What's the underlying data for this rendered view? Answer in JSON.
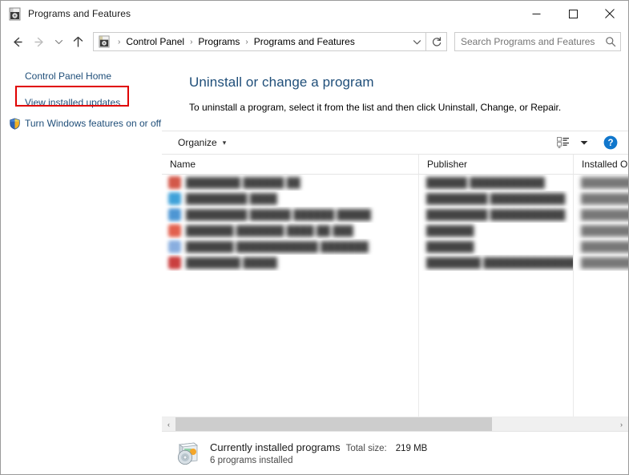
{
  "window": {
    "title": "Programs and Features",
    "icon": "programs-and-features-icon",
    "minimize_label": "Minimize",
    "maximize_label": "Maximize",
    "close_label": "Close"
  },
  "nav": {
    "back_label": "Back",
    "forward_label": "Forward",
    "recent_label": "Recent locations",
    "up_label": "Up",
    "refresh_label": "Refresh",
    "breadcrumbs": [
      {
        "label": "Control Panel"
      },
      {
        "label": "Programs"
      },
      {
        "label": "Programs and Features"
      }
    ],
    "breadcrumb_separator": "›"
  },
  "search": {
    "placeholder": "Search Programs and Features",
    "value": ""
  },
  "sidebar": {
    "items": [
      {
        "label": "Control Panel Home",
        "icon": null,
        "highlighted": false
      },
      {
        "label": "View installed updates",
        "icon": null,
        "highlighted": true
      },
      {
        "label": "Turn Windows features on or off",
        "icon": "shield-icon",
        "highlighted": false
      }
    ]
  },
  "main": {
    "title": "Uninstall or change a program",
    "subtitle": "To uninstall a program, select it from the list and then click Uninstall, Change, or Repair."
  },
  "toolbar": {
    "organize_label": "Organize",
    "organize_caret": "▾",
    "view_icon": "view-options-icon",
    "view_caret": "▾",
    "help_icon": "help-icon",
    "help_label": "?"
  },
  "list": {
    "columns": [
      {
        "label": "Name",
        "sorted": true,
        "sort_direction": "ascending"
      },
      {
        "label": "Publisher",
        "sorted": false,
        "sort_direction": null
      },
      {
        "label": "Installed On",
        "sorted": false,
        "sort_direction": null
      }
    ],
    "sort_caret": "˄",
    "rows": [
      {
        "name": "████████ ██████ ██",
        "publisher": "██████ ███████████",
        "installed_on": "████████",
        "icon_color": "#d04a3a"
      },
      {
        "name": "█████████ ████",
        "publisher": "█████████ ███████████",
        "installed_on": "████████",
        "icon_color": "#2f9ad6"
      },
      {
        "name": "█████████ ██████ ██████ █████",
        "publisher": "█████████ ███████████",
        "installed_on": "████████",
        "icon_color": "#3f8ed0"
      },
      {
        "name": "███████ ███████ ████ ██ ███",
        "publisher": "███████",
        "installed_on": "████████",
        "icon_color": "#e0533f"
      },
      {
        "name": "███████ ████████████ ███████",
        "publisher": "███████",
        "installed_on": "████████",
        "icon_color": "#7fa8dd"
      },
      {
        "name": "████████ █████",
        "publisher": "████████ ██████████████ █████",
        "installed_on": "████████",
        "icon_color": "#c62f2f"
      }
    ],
    "scroll_left_arrow": "‹",
    "scroll_right_arrow": "›"
  },
  "status": {
    "icon": "installed-programs-icon",
    "heading": "Currently installed programs",
    "total_size_label": "Total size:",
    "total_size_value": "219 MB",
    "count_text": "6 programs installed"
  },
  "colors": {
    "link": "#1f4e79",
    "heading": "#1f4e79",
    "annotation": "#e00000",
    "help_blue": "#1177cc",
    "scrollbar_thumb": "#cdcdcd"
  }
}
